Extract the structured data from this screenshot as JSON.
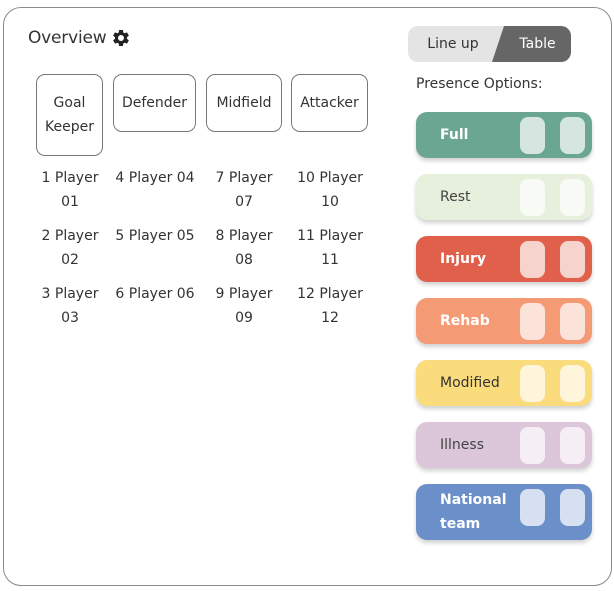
{
  "overview": {
    "title": "Overview"
  },
  "positions": [
    {
      "label": "Goal Keeper"
    },
    {
      "label": "Defender"
    },
    {
      "label": "Midfield"
    },
    {
      "label": "Attacker"
    }
  ],
  "players": [
    [
      "1 Player 01",
      "2 Player 02",
      "3 Player 03"
    ],
    [
      "4 Player 04",
      "5 Player 05",
      "6 Player 06"
    ],
    [
      "7 Player 07",
      "8 Player 08",
      "9 Player 09"
    ],
    [
      "10 Player 10",
      "11 Player 11",
      "12 Player 12"
    ]
  ],
  "view_toggle": {
    "lineup_label": "Line up",
    "table_label": "Table",
    "selected": "Table"
  },
  "presence": {
    "label": "Presence Options:",
    "options": [
      {
        "label": "Full",
        "color": "#6aa692",
        "text_color": "#ffffff"
      },
      {
        "label": "Rest",
        "color": "#e6f0dc",
        "text_color": "#444444"
      },
      {
        "label": "Injury",
        "color": "#e0604c",
        "text_color": "#ffffff"
      },
      {
        "label": "Rehab",
        "color": "#f49b76",
        "text_color": "#ffffff"
      },
      {
        "label": "Modified",
        "color": "#fbdc7d",
        "text_color": "#333333"
      },
      {
        "label": "Illness",
        "color": "#dcc6da",
        "text_color": "#444444"
      },
      {
        "label": "National team",
        "color": "#6b8fc8",
        "text_color": "#ffffff"
      }
    ]
  },
  "icons": {
    "settings": "gear-icon"
  }
}
